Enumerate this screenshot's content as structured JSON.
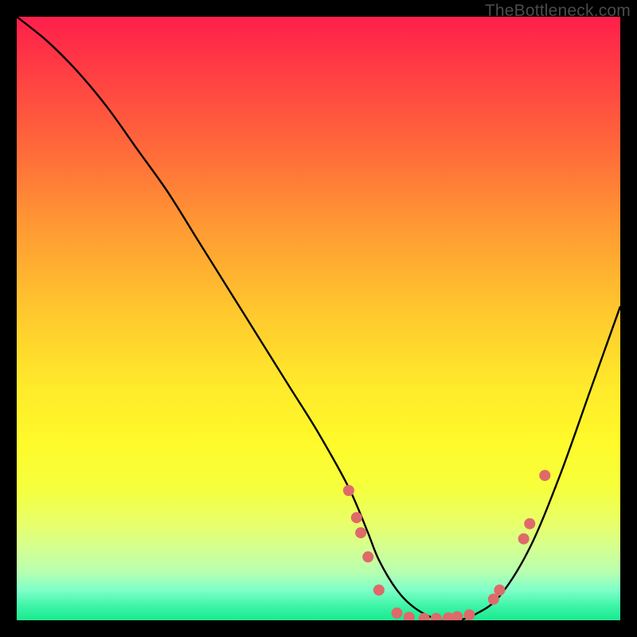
{
  "watermark": "TheBottleneck.com",
  "chart_data": {
    "type": "line",
    "title": "",
    "xlabel": "",
    "ylabel": "",
    "xlim": [
      0,
      100
    ],
    "ylim": [
      0,
      100
    ],
    "series": [
      {
        "name": "curve",
        "x": [
          0,
          5,
          10,
          15,
          20,
          25,
          30,
          35,
          40,
          45,
          50,
          55,
          58,
          60,
          63,
          66,
          70,
          73,
          76,
          80,
          85,
          90,
          95,
          100
        ],
        "y": [
          100,
          96,
          91,
          85,
          78,
          71,
          63,
          55,
          47,
          39,
          31,
          22,
          15,
          10,
          5,
          2,
          0,
          0,
          1,
          4,
          12,
          24,
          38,
          52
        ]
      }
    ],
    "dots": [
      {
        "x": 55.0,
        "y": 21.5
      },
      {
        "x": 56.3,
        "y": 17.0
      },
      {
        "x": 57.0,
        "y": 14.5
      },
      {
        "x": 58.2,
        "y": 10.5
      },
      {
        "x": 60.0,
        "y": 5.0
      },
      {
        "x": 63.0,
        "y": 1.2
      },
      {
        "x": 65.0,
        "y": 0.5
      },
      {
        "x": 67.5,
        "y": 0.3
      },
      {
        "x": 69.5,
        "y": 0.3
      },
      {
        "x": 71.5,
        "y": 0.4
      },
      {
        "x": 73.0,
        "y": 0.6
      },
      {
        "x": 75.0,
        "y": 0.9
      },
      {
        "x": 79.0,
        "y": 3.5
      },
      {
        "x": 80.0,
        "y": 5.0
      },
      {
        "x": 84.0,
        "y": 13.5
      },
      {
        "x": 85.0,
        "y": 16.0
      },
      {
        "x": 87.5,
        "y": 24.0
      }
    ],
    "colors": {
      "curve": "#000000",
      "dots": "#de6a6a",
      "background_top": "#ff1f4b",
      "background_bottom": "#1de98e"
    }
  }
}
